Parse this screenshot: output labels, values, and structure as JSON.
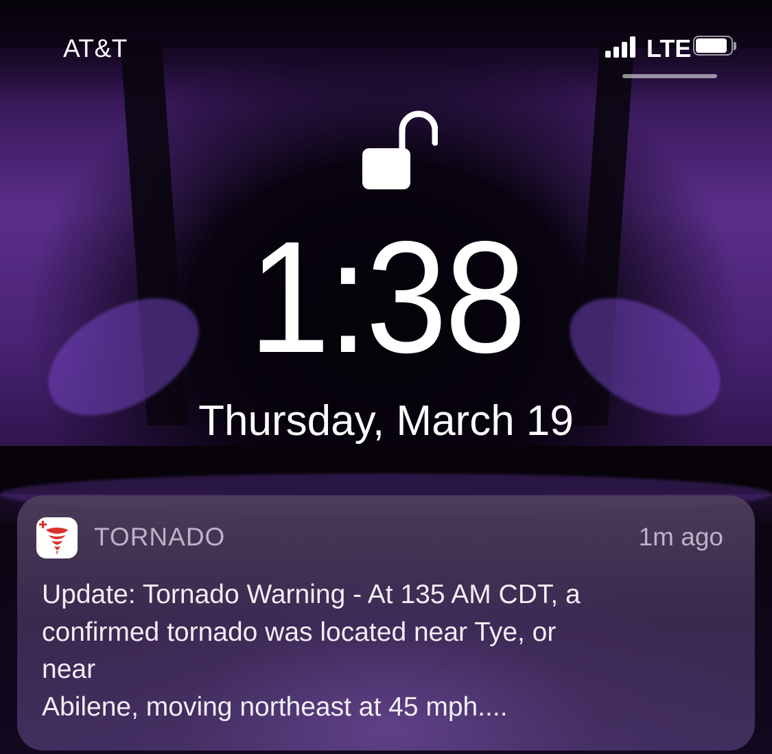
{
  "status_bar": {
    "carrier": "AT&T",
    "network_type": "LTE",
    "signal_icon": "signal-bars-icon",
    "battery_icon": "battery-icon",
    "battery_level": 0.9
  },
  "lock_screen": {
    "lock_icon": "unlocked-padlock-icon",
    "time": "1:38",
    "date": "Thursday, March 19"
  },
  "notification": {
    "app_icon": "tornado-app-icon",
    "app_name": "TORNADO",
    "time_ago": "1m ago",
    "body_lines": [
      "Update: Tornado Warning - At 135 AM CDT, a",
      "confirmed tornado was located near Tye, or",
      "near",
      "Abilene, moving northeast at 45 mph...."
    ]
  },
  "colors": {
    "wallpaper_accent": "#5a2e8a",
    "notification_bg": "#4e405c",
    "app_icon_red": "#d9302c"
  }
}
